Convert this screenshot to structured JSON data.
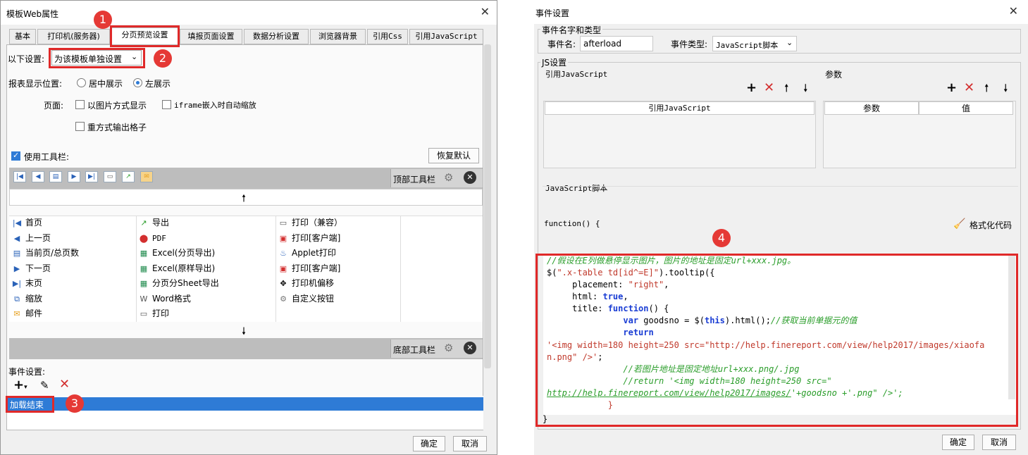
{
  "left_dialog": {
    "title": "模板Web属性",
    "tabs": [
      "基本",
      "打印机(服务器)",
      "分页预览设置",
      "填报页面设置",
      "数据分析设置",
      "浏览器背景",
      "引用Css",
      "引用JavaScript"
    ],
    "setting_label": "以下设置:",
    "setting_value": "为该模板单独设置",
    "report_position_label": "报表显示位置:",
    "center_label": "居中展示",
    "left_label": "左展示",
    "page_label": "页面:",
    "image_mode_label": "以图片方式显示",
    "iframe_label": "iframe嵌入时自动缩放",
    "repeat_label": "重方式输出格子",
    "use_toolbar_label": "使用工具栏:",
    "restore_default": "恢复默认",
    "top_toolbar": "顶部工具栏",
    "bottom_toolbar": "底部工具栏",
    "toolbar_items": [
      [
        "首页",
        "导出",
        "打印（兼容）"
      ],
      [
        "上一页",
        "PDF",
        "打印[客户端]"
      ],
      [
        "当前页/总页数",
        "Excel(分页导出)",
        "Applet打印"
      ],
      [
        "下一页",
        "Excel(原样导出)",
        "打印[客户端]"
      ],
      [
        "末页",
        "分页分Sheet导出",
        "打印机偏移"
      ],
      [
        "缩放",
        "Word格式",
        "自定义按钮"
      ],
      [
        "邮件",
        "打印",
        ""
      ]
    ],
    "event_label": "事件设置:",
    "event_item": "加载结束",
    "ok": "确定",
    "cancel": "取消"
  },
  "right_dialog": {
    "title": "事件设置",
    "group_name_type": "事件名字和类型",
    "event_name_label": "事件名:",
    "event_name_value": "afterload",
    "event_type_label": "事件类型:",
    "event_type_value": "JavaScript脚本",
    "js_group": "JS设置",
    "ref_js_label": "引用JavaScript",
    "params_label": "参数",
    "ref_js_header": "引用JavaScript",
    "param_header": "参数",
    "value_header": "值",
    "script_label": "JavaScript脚本",
    "function_decl": "function() {",
    "format_code": "格式化代码",
    "code_close": "}",
    "ok": "确定",
    "cancel": "取消"
  },
  "badges": [
    "1",
    "2",
    "3",
    "4"
  ],
  "colors": {
    "highlight": "#e02929",
    "selection": "#2e7bd6",
    "badge": "#e53935"
  }
}
